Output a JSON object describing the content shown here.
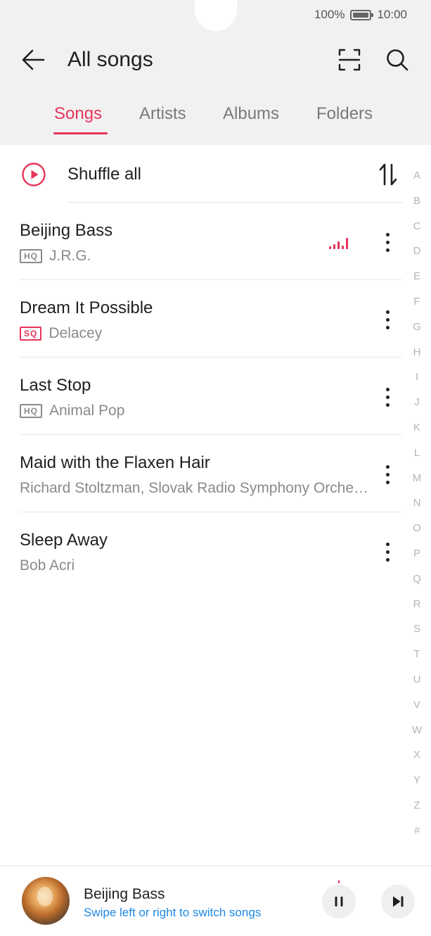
{
  "status_bar": {
    "battery_text": "100%",
    "time": "10:00"
  },
  "header": {
    "title": "All songs"
  },
  "tabs": [
    {
      "label": "Songs",
      "active": true
    },
    {
      "label": "Artists",
      "active": false
    },
    {
      "label": "Albums",
      "active": false
    },
    {
      "label": "Folders",
      "active": false
    }
  ],
  "shuffle": {
    "label": "Shuffle all"
  },
  "songs": [
    {
      "title": "Beijing Bass",
      "quality": "HQ",
      "artist": "J.R.G.",
      "playing": true
    },
    {
      "title": "Dream It Possible",
      "quality": "SQ",
      "artist": "Delacey",
      "playing": false
    },
    {
      "title": "Last Stop",
      "quality": "HQ",
      "artist": "Animal Pop",
      "playing": false
    },
    {
      "title": "Maid with the Flaxen Hair",
      "quality": "",
      "artist": "Richard Stoltzman, Slovak Radio Symphony Orchestra",
      "playing": false
    },
    {
      "title": "Sleep Away",
      "quality": "",
      "artist": "Bob Acri",
      "playing": false
    }
  ],
  "alpha_index": [
    "A",
    "B",
    "C",
    "D",
    "E",
    "F",
    "G",
    "H",
    "I",
    "J",
    "K",
    "L",
    "M",
    "N",
    "O",
    "P",
    "Q",
    "R",
    "S",
    "T",
    "U",
    "V",
    "W",
    "X",
    "Y",
    "Z",
    "#"
  ],
  "mini_player": {
    "title": "Beijing Bass",
    "hint": "Swipe left or right to switch songs"
  },
  "colors": {
    "accent": "#e8345a",
    "hint_blue": "#1e88e5",
    "header_bg": "#f1f1f1"
  },
  "icons": [
    "back-arrow-icon",
    "scan-icon",
    "search-icon",
    "play-circle-icon",
    "sort-icon",
    "playing-bars-icon",
    "more-vert-icon",
    "pause-icon",
    "skip-next-icon"
  ]
}
